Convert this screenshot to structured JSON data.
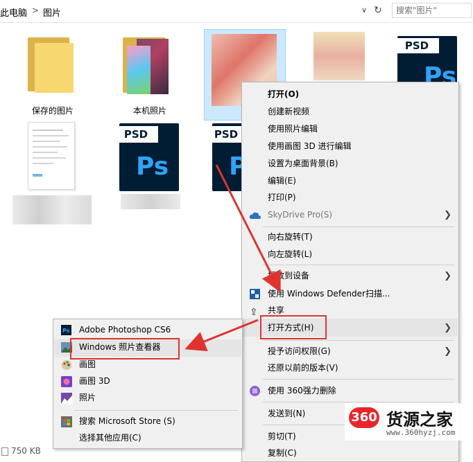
{
  "breadcrumb": {
    "item1": "此电脑",
    "sep": ">",
    "item2": "图片"
  },
  "search": {
    "placeholder": "搜索\"图片\""
  },
  "files": {
    "folder1_label": "保存的图片",
    "folder2_label": "本机照片",
    "psd_tag": "PSD",
    "ps_glyph": "Ps"
  },
  "status": {
    "size": "750 KB"
  },
  "context_menu": {
    "open": "打开(O)",
    "new_video": "创建新视频",
    "edit_photos": "使用照片编辑",
    "edit_paint3d": "使用画图 3D 进行编辑",
    "set_bg": "设置为桌面背景(B)",
    "edit": "编辑(E)",
    "print": "打印(P)",
    "skydrive": "SkyDrive Pro(S)",
    "rotate_right": "向右旋转(T)",
    "rotate_left": "向左旋转(L)",
    "cast": "播放到设备",
    "defender": "使用 Windows Defender扫描...",
    "share": "共享",
    "open_with": "打开方式(H)",
    "grant_access": "授予访问权限(G)",
    "restore": "还原以前的版本(V)",
    "delete_360": "使用 360强力删除",
    "send_to": "发送到(N)",
    "cut": "剪切(T)",
    "copy": "复制(C)"
  },
  "submenu": {
    "photoshop": "Adobe Photoshop CS6",
    "viewer": "Windows 照片查看器",
    "paint": "画图",
    "paint3d": "画图 3D",
    "photos": "照片",
    "store": "搜索 Microsoft Store (S)",
    "other": "选择其他应用(C)"
  },
  "watermark": {
    "logo": "360",
    "name": "货源之家",
    "url": "www.360hyzj.com"
  },
  "colors": {
    "accent_red": "#e0332e",
    "selection": "#cce8ff",
    "psd_bg": "#001d34",
    "ps_blue": "#2fa3f7"
  }
}
